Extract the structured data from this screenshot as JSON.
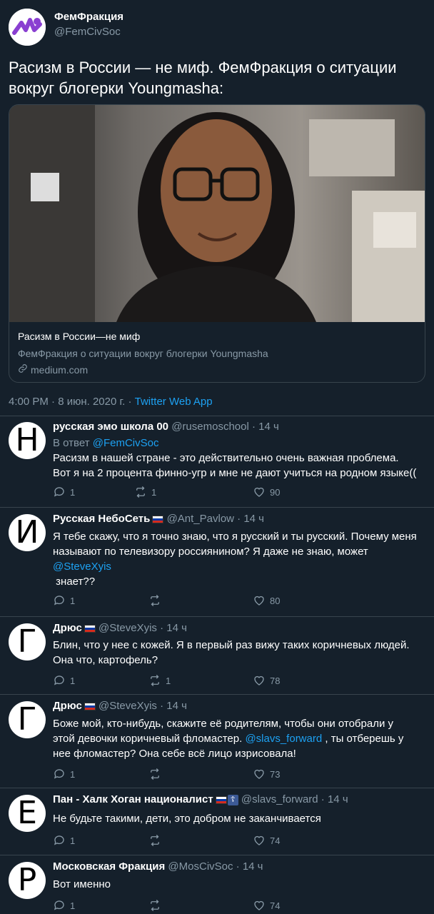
{
  "author": {
    "name": "ФемФракция",
    "handle": "@FemCivSoc",
    "avatar_color": "#8a3fd1"
  },
  "tweet": {
    "text_line1": "Расизм в России — не миф. ФемФракция о ситуации",
    "text_line2": "вокруг блогерки Youngmasha:",
    "card": {
      "title": "Расизм в России—не миф",
      "description": "ФемФракция о ситуации вокруг блогерки Youngmasha",
      "link": "medium.com"
    },
    "time": "4:00 PM · 8 июн. 2020 г. · ",
    "app": "Twitter Web App"
  },
  "replies": [
    {
      "avatar_letter": "Н",
      "name": "русская эмо школа 00",
      "handle": "@rusemoschool · 14 ч",
      "reply_to_label": "В ответ ",
      "reply_to": "@FemCivSoc",
      "line1": "Расизм в нашей стране - это действительно очень важная проблема.",
      "line2": "Вот я на 2 процента финно-угр и мне не дают учиться на родном языке((",
      "replies": "1",
      "retweets": "1",
      "likes": "90"
    },
    {
      "avatar_letter": "И",
      "name": "Русская НебоСеть",
      "handle": "@Ant_Pavlow · 14 ч",
      "line1": "Я тебе скажу, что я точно знаю, что я русский и ты русский. Почему меня",
      "line2": "называют по телевизору россиянином? Я даже не знаю, может",
      "mention": "@SteveXyis",
      "line3": " знает??",
      "replies": "1",
      "retweets": "",
      "likes": "80"
    },
    {
      "avatar_letter": "Г",
      "name": "Дрюс",
      "handle": "@SteveXyis · 14 ч",
      "line1": "Блин, что у нее с кожей. Я в первый раз вижу таких коричневых людей.",
      "line2": "Она что, картофель?",
      "replies": "1",
      "retweets": "1",
      "likes": "78"
    },
    {
      "avatar_letter": "Г",
      "name": "Дрюс",
      "handle": "@SteveXyis · 14 ч",
      "line1": "Боже мой, кто-нибудь, скажите её родителям, чтобы они отобрали у",
      "line2a": "этой девочки коричневый фломастер. ",
      "mention": "@slavs_forward",
      "line2b": " , ты отберешь у",
      "line3": "нее фломастер? Она себе всё лицо изрисовала!",
      "replies": "1",
      "retweets": "",
      "likes": "73"
    },
    {
      "avatar_letter": "Е",
      "name": "Пан - Халк Хоган националист",
      "handle": "@slavs_forward · 14 ч",
      "line1": "Не будьте такими, дети, это добром не заканчивается",
      "replies": "1",
      "retweets": "",
      "likes": "74"
    },
    {
      "avatar_letter": "Р",
      "name": "Московская Фракция",
      "handle": "@MosCivSoc · 14 ч",
      "line1": "Вот именно",
      "replies": "1",
      "retweets": "",
      "likes": "74"
    }
  ]
}
